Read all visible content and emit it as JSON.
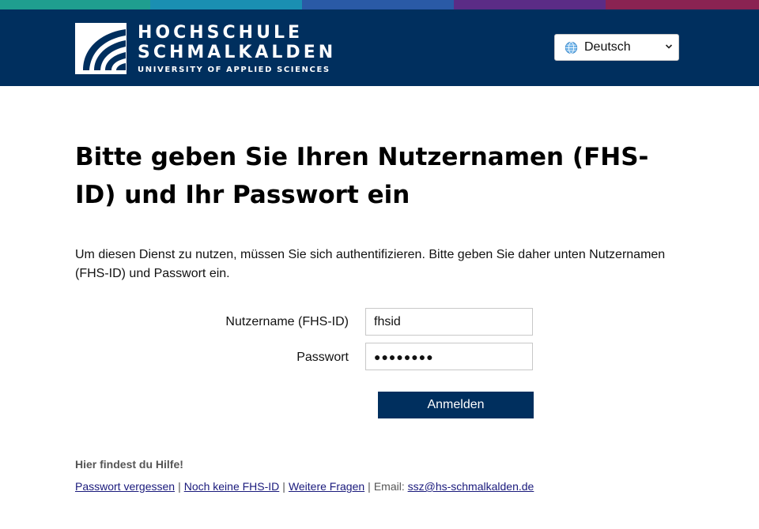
{
  "colors": {
    "header_bg": "#002f5e",
    "strip": [
      "#1f9e8f",
      "#1a8fb2",
      "#2a5aa6",
      "#5b2c86",
      "#8a2352"
    ]
  },
  "header": {
    "logo": {
      "line1": "HOCHSCHULE",
      "line2": "SCHMALKALDEN",
      "line3": "UNIVERSITY OF APPLIED SCIENCES"
    },
    "language": {
      "icon": "globe-icon",
      "selected": "Deutsch"
    }
  },
  "main": {
    "title": "Bitte geben Sie Ihren Nutzernamen (FHS-ID) und Ihr Passwort ein",
    "intro": "Um diesen Dienst zu nutzen, müssen Sie sich authentifizieren. Bitte geben Sie daher unten Nutzernamen (FHS-ID) und Passwort ein.",
    "form": {
      "username_label": "Nutzername (FHS-ID)",
      "username_value": "fhsid",
      "password_label": "Passwort",
      "password_display": "●●●●●●●●",
      "submit_label": "Anmelden"
    },
    "help": {
      "heading": "Hier findest du Hilfe!",
      "links": {
        "forgot": "Passwort vergessen",
        "no_id": "Noch keine FHS-ID",
        "more": "Weitere Fragen",
        "email_prefix": "Email:",
        "email": "ssz@hs-schmalkalden.de"
      },
      "separator": "|"
    }
  }
}
